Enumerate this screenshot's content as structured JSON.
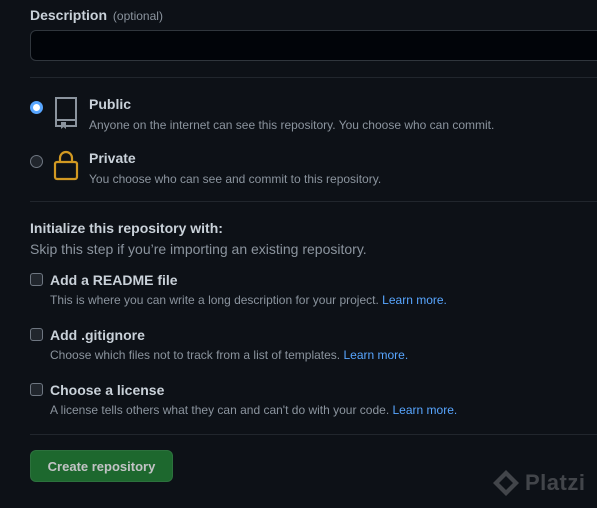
{
  "description": {
    "label": "Description",
    "optional": "(optional)",
    "value": ""
  },
  "visibility": {
    "public": {
      "title": "Public",
      "description": "Anyone on the internet can see this repository. You choose who can commit.",
      "checked": true,
      "icon": "repo-icon"
    },
    "private": {
      "title": "Private",
      "description": "You choose who can see and commit to this repository.",
      "checked": false,
      "icon": "lock-icon"
    }
  },
  "initialize": {
    "title": "Initialize this repository with:",
    "subtitle": "Skip this step if you’re importing an existing repository.",
    "options": [
      {
        "title": "Add a README file",
        "description": "This is where you can write a long description for your project.",
        "link": "Learn more.",
        "checked": false
      },
      {
        "title": "Add .gitignore",
        "description": "Choose which files not to track from a list of templates.",
        "link": "Learn more.",
        "checked": false
      },
      {
        "title": "Choose a license",
        "description": "A license tells others what they can and can't do with your code.",
        "link": "Learn more.",
        "checked": false
      }
    ]
  },
  "create_button": {
    "label": "Create repository"
  },
  "watermark": {
    "text": "Platzi"
  },
  "colors": {
    "background": "#0d1117",
    "accent": "#58a6ff",
    "button": "#238636",
    "lock": "#d29922"
  }
}
